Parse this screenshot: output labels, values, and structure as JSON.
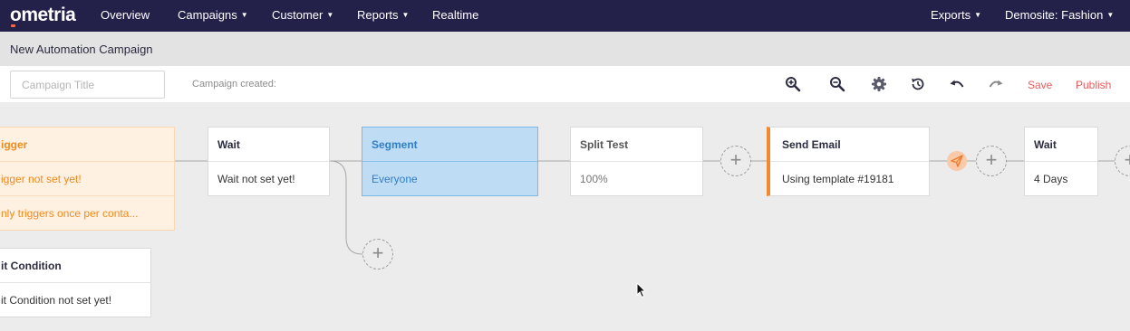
{
  "nav": {
    "logo": "ometria",
    "overview": "Overview",
    "campaigns": "Campaigns",
    "customer": "Customer",
    "reports": "Reports",
    "realtime": "Realtime",
    "exports": "Exports",
    "demosite": "Demosite: Fashion"
  },
  "page": {
    "title": "New Automation Campaign"
  },
  "toolbar": {
    "title_placeholder": "Campaign Title",
    "title_value": "",
    "created_label": "Campaign created:",
    "save_label": "Save",
    "publish_label": "Publish",
    "icons": [
      "zoom-in-icon",
      "zoom-out-icon",
      "gear-icon",
      "history-icon",
      "undo-icon",
      "redo-icon"
    ]
  },
  "nodes": {
    "trigger": {
      "title": "igger",
      "body1": "igger not set yet!",
      "body2": "nly triggers once per conta..."
    },
    "exit": {
      "title": "it Condition",
      "body": "it Condition not set yet!"
    },
    "wait1": {
      "title": "Wait",
      "body": "Wait not set yet!"
    },
    "segment": {
      "title": "Segment",
      "body": "Everyone"
    },
    "split": {
      "title": "Split Test",
      "body": "100%"
    },
    "email": {
      "title": "Send Email",
      "body": "Using template #19181"
    },
    "wait2": {
      "title": "Wait",
      "body": "4 Days"
    }
  },
  "add_symbol": "+",
  "colors": {
    "nav_bg": "#23204a",
    "accent_red": "#ef5b5b",
    "trigger_orange": "#f08a1c",
    "segment_blue": "#bfdcf5",
    "email_accent": "#f08a30"
  }
}
